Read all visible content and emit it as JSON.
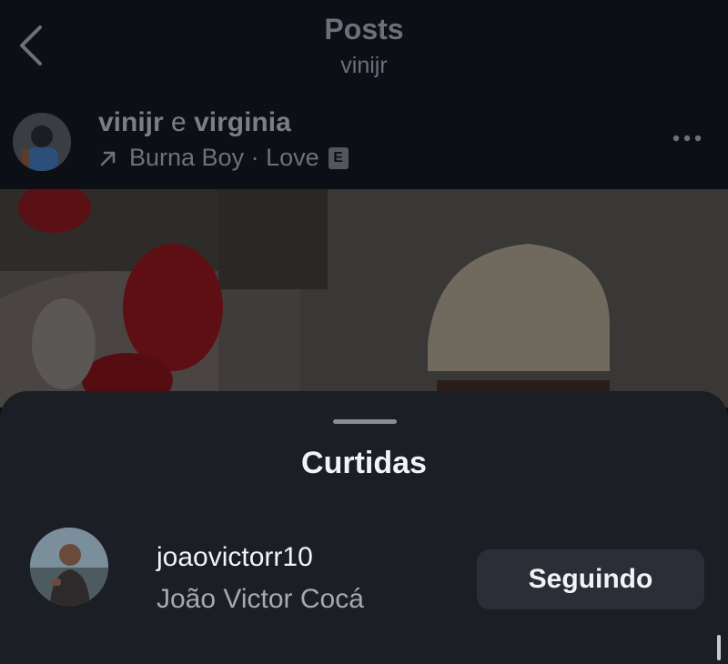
{
  "header": {
    "title": "Posts",
    "subtitle": "vinijr",
    "back_icon": "chevron-left-icon"
  },
  "post": {
    "author_primary": "vinijr",
    "conjunction": " e ",
    "author_collab": "virginia",
    "music_icon": "arrow-up-right-icon",
    "music": "Burna Boy · Love",
    "explicit_badge": "E",
    "more_icon": "ellipsis-icon"
  },
  "likes_sheet": {
    "title": "Curtidas",
    "users": [
      {
        "username": "joaovictorr10",
        "full_name": "João Victor Cocá",
        "follow_label": "Seguindo"
      }
    ]
  },
  "colors": {
    "background": "#0b0d14",
    "sheet": "#1c1e26",
    "button": "#2b2e36",
    "text_primary": "#f2f3f5",
    "text_secondary": "#a7a9b0"
  }
}
